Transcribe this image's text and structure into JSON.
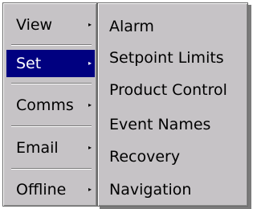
{
  "menu": {
    "items": [
      {
        "label": "View",
        "arrow": "▸"
      },
      {
        "label": "Set",
        "arrow": "▸"
      },
      {
        "label": "Comms",
        "arrow": "▸"
      },
      {
        "label": "Email",
        "arrow": "▸"
      },
      {
        "label": "Offline",
        "arrow": "▸"
      }
    ],
    "selected_color": "#000080"
  },
  "submenu": {
    "items": [
      {
        "label": "Alarm"
      },
      {
        "label": "Setpoint Limits"
      },
      {
        "label": "Product Control"
      },
      {
        "label": "Event Names"
      },
      {
        "label": "Recovery"
      },
      {
        "label": "Navigation"
      }
    ]
  }
}
